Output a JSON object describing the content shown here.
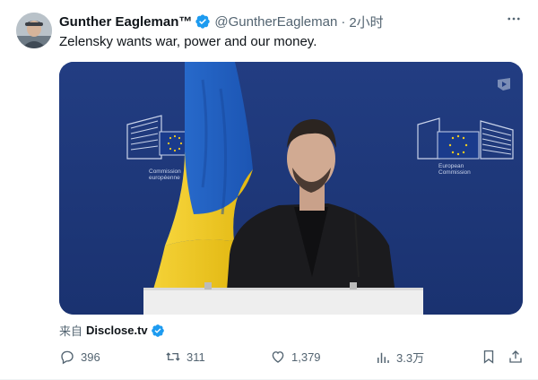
{
  "tweet": {
    "author_name": "Gunther Eagleman™",
    "handle": "@GuntherEagleman",
    "separator": "·",
    "time": "2小时",
    "text": "Zelensky wants war, power and our money.",
    "more_icon": "more-icon",
    "verified_icon": "verified-badge-icon"
  },
  "media": {
    "left_plaque_line1": "Commission",
    "left_plaque_line2": "européenne",
    "right_plaque_line1": "European",
    "right_plaque_line2": "Commission",
    "watermark_icon": "video-source-logo-icon",
    "background_color": "#1f3a7a"
  },
  "source": {
    "prefix": "来自",
    "name": "Disclose.tv",
    "verified_icon": "verified-badge-icon"
  },
  "actions": {
    "reply_count": "396",
    "retweet_count": "311",
    "like_count": "1,379",
    "view_count": "3.3万",
    "icons": [
      "reply-icon",
      "retweet-icon",
      "like-icon",
      "views-icon",
      "bookmark-icon",
      "share-icon"
    ]
  },
  "colors": {
    "verified_blue": "#1d9bf0",
    "muted_text": "#536471",
    "text": "#0f1419",
    "ukraine_blue": "#1f63c8",
    "ukraine_yellow": "#f3cc1e"
  }
}
